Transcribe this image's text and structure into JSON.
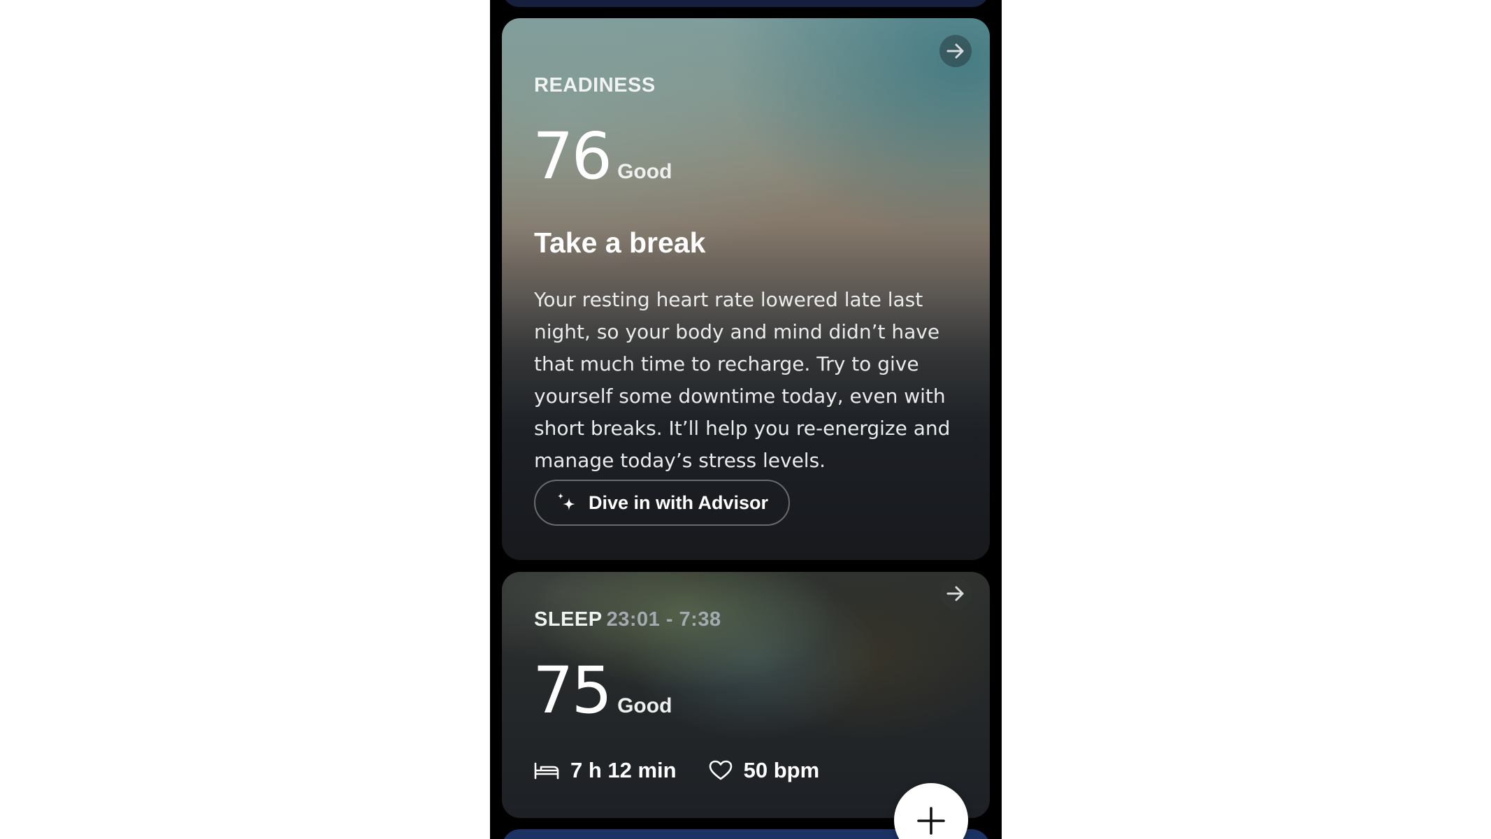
{
  "readiness": {
    "label": "READINESS",
    "score": "76",
    "status": "Good",
    "headline": "Take a break",
    "body": "Your resting heart rate lowered late last night, so your body and mind didn’t have that much time to recharge. Try to give yourself some downtime today, even with short breaks. It’ll help you re-energize and manage today’s stress levels.",
    "advisor_button": "Dive in with Advisor",
    "icons": {
      "open": "arrow-right-icon",
      "advisor": "sparkle-icon"
    }
  },
  "sleep": {
    "label": "SLEEP",
    "time_range": "23:01 - 7:38",
    "score": "75",
    "status": "Good",
    "duration": "7 h 12 min",
    "heart_rate": "50 bpm",
    "icons": {
      "open": "arrow-right-icon",
      "duration": "bed-icon",
      "heart_rate": "heart-icon"
    }
  },
  "fab": {
    "icon": "plus-icon"
  },
  "colors": {
    "background": "#000000",
    "top_card": "#15203f",
    "bottom_card": "#1b3263",
    "text": "#ffffff",
    "muted_text": "#a3aab0"
  }
}
